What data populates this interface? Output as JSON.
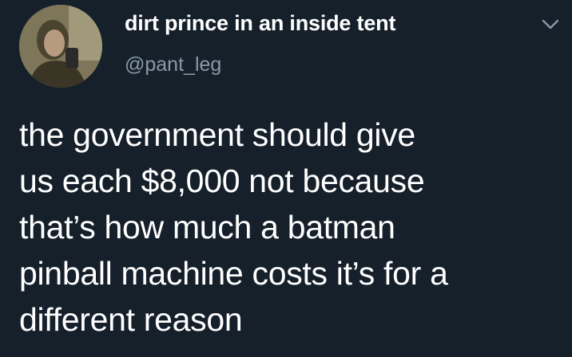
{
  "author": {
    "display_name": "dirt prince in an inside tent",
    "handle": "@pant_leg"
  },
  "header": {
    "menu_icon": "chevron-down-icon"
  },
  "tweet": {
    "lines": [
      "the government should give",
      "us each $8,000 not because",
      "that’s how much a batman",
      "pinball machine costs it’s for a",
      "different reason"
    ]
  },
  "colors": {
    "background": "#15202b",
    "primary_text": "#ffffff",
    "secondary_text": "#8899a6"
  }
}
